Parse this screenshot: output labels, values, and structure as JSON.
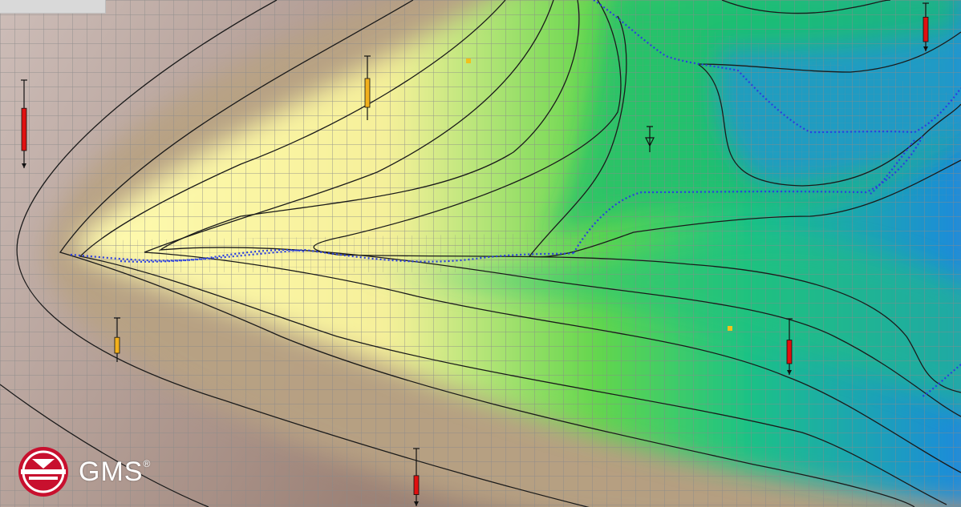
{
  "app": {
    "logo_text": "GMS",
    "logo_mark": "®"
  },
  "colors": {
    "brand_red": "#c8102e",
    "grid_line": "#8a8a8a",
    "contour_line": "#1a1a1a",
    "particle_blue": "#2a3fe0",
    "well_extraction": "#e01010",
    "well_injection": "#f2b01c"
  },
  "wells": [
    {
      "type": "extraction",
      "level": 0.8
    },
    {
      "type": "injection",
      "level": 0.75
    },
    {
      "type": "injection",
      "level": 0.6
    },
    {
      "type": "extraction",
      "level": 0.7
    },
    {
      "type": "extraction",
      "level": 0.85
    },
    {
      "type": "extraction",
      "level": 0.55
    }
  ],
  "icons": [
    "gms-logo-icon",
    "well-icon",
    "observation-point-icon",
    "water-table-marker-icon"
  ]
}
